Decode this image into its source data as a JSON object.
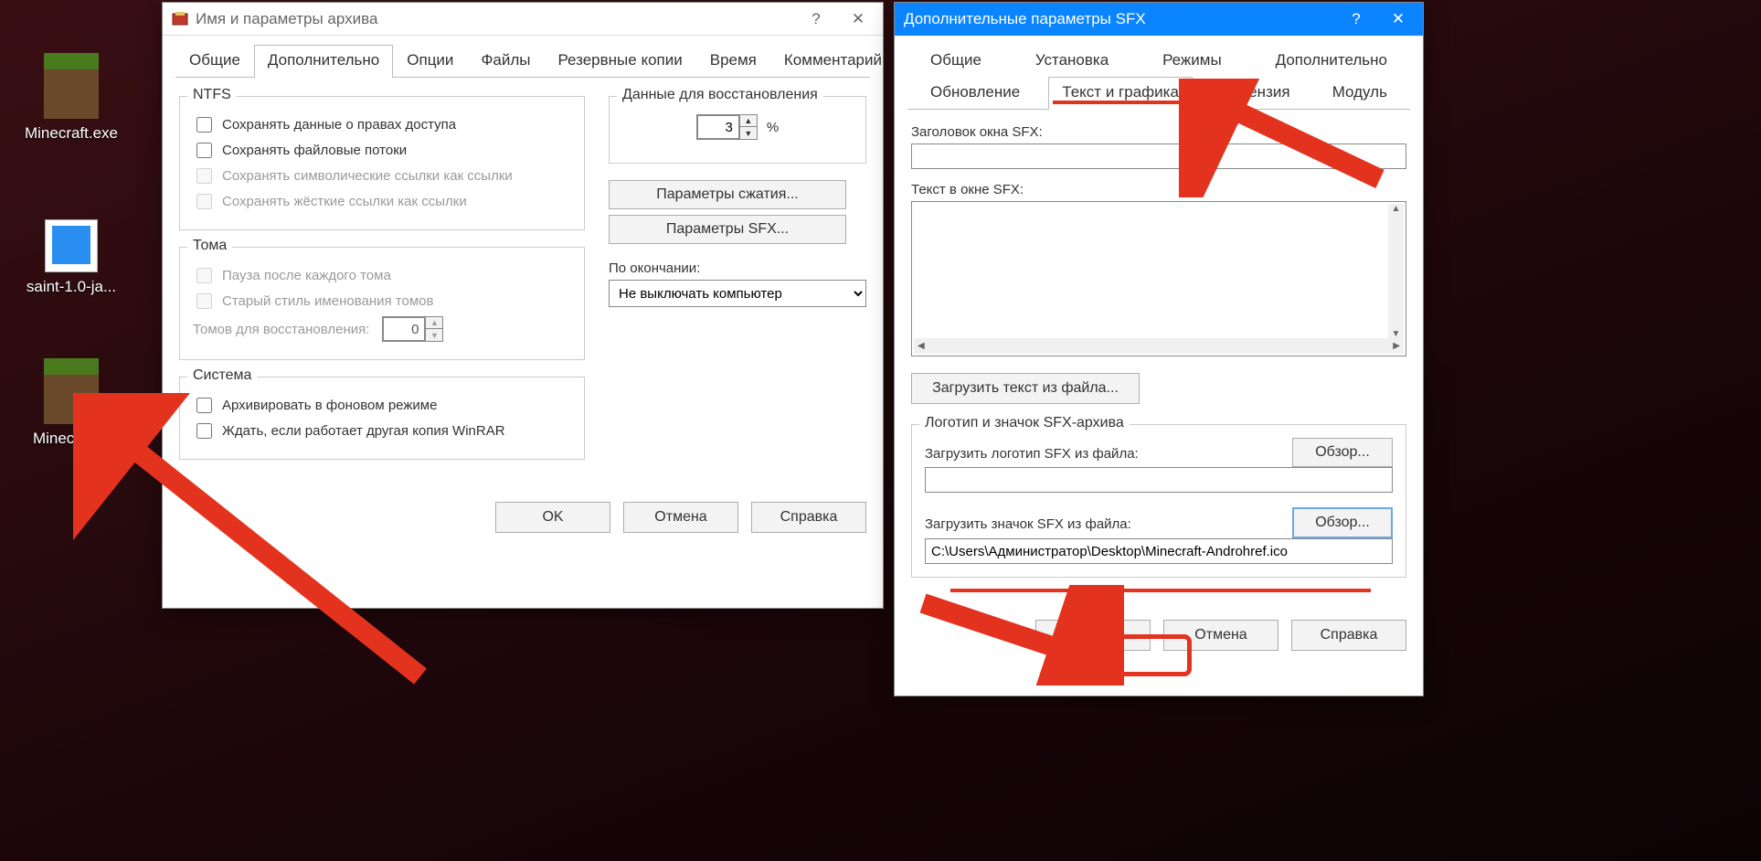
{
  "desktop": {
    "icons": [
      {
        "label": "Minecraft.exe"
      },
      {
        "label": "saint-1.0-ja..."
      },
      {
        "label": "Minecraft..."
      }
    ]
  },
  "win1": {
    "title": "Имя и параметры архива",
    "tabs": [
      "Общие",
      "Дополнительно",
      "Опции",
      "Файлы",
      "Резервные копии",
      "Время",
      "Комментарий"
    ],
    "active_tab": "Дополнительно",
    "ntfs": {
      "legend": "NTFS",
      "cb1": "Сохранять данные о правах доступа",
      "cb2": "Сохранять файловые потоки",
      "cb3": "Сохранять символические ссылки как ссылки",
      "cb4": "Сохранять жёсткие ссылки как ссылки"
    },
    "volumes": {
      "legend": "Тома",
      "cb1": "Пауза после каждого тома",
      "cb2": "Старый стиль именования томов",
      "recov_label": "Томов для восстановления:",
      "recov_value": "0"
    },
    "system": {
      "legend": "Система",
      "cb1": "Архивировать в фоновом режиме",
      "cb2": "Ждать, если работает другая копия WinRAR"
    },
    "recovery": {
      "legend": "Данные для восстановления",
      "value": "3",
      "unit": "%"
    },
    "btn_compress": "Параметры сжатия...",
    "btn_sfx": "Параметры SFX...",
    "after_label": "По окончании:",
    "after_value": "Не выключать компьютер",
    "ok": "OK",
    "cancel": "Отмена",
    "help": "Справка"
  },
  "win2": {
    "title": "Дополнительные параметры SFX",
    "tabs_row1": [
      "Общие",
      "Установка",
      "Режимы",
      "Дополнительно"
    ],
    "tabs_row2": [
      "Обновление",
      "Текст и графика",
      "Лицензия",
      "Модуль"
    ],
    "active_tab": "Текст и графика",
    "label_title": "Заголовок окна SFX:",
    "label_text": "Текст в окне SFX:",
    "btn_loadtext": "Загрузить текст из файла...",
    "group_logo": {
      "legend": "Логотип и значок SFX-архива",
      "label_logo": "Загрузить логотип SFX из файла:",
      "label_icon": "Загрузить значок SFX из файла:",
      "browse": "Обзор...",
      "icon_path": "C:\\Users\\Администратор\\Desktop\\Minecraft-Androhref.ico"
    },
    "ok": "OK",
    "cancel": "Отмена",
    "help": "Справка"
  }
}
